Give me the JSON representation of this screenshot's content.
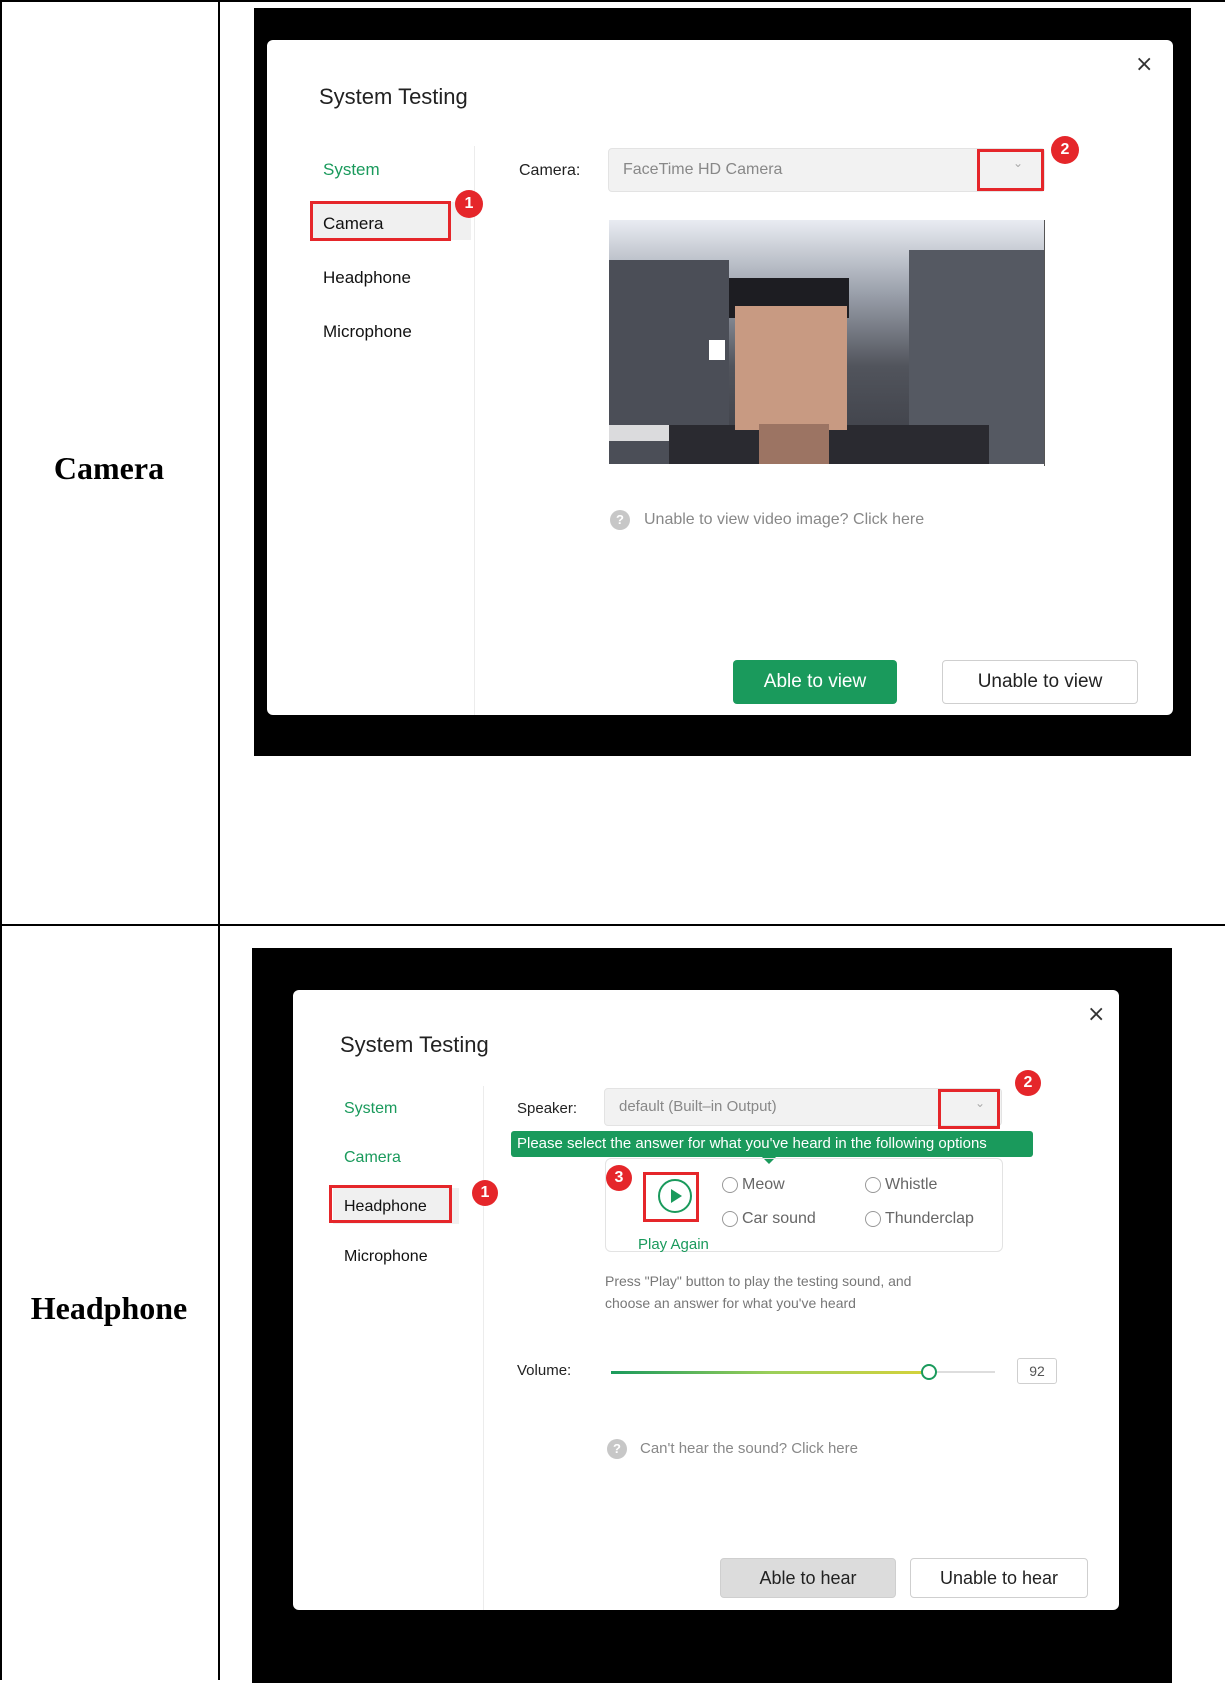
{
  "rows": [
    {
      "label": "Camera",
      "dialog": {
        "title": "System Testing",
        "nav": [
          "System",
          "Camera",
          "Headphone",
          "Microphone"
        ],
        "field_label": "Camera:",
        "select_value": "FaceTime HD Camera",
        "help_text": "Unable to view video image? Click here",
        "buttons": [
          "Able to view",
          "Unable to view"
        ],
        "badges": [
          "1",
          "2"
        ]
      }
    },
    {
      "label": "Headphone",
      "dialog": {
        "title": "System Testing",
        "nav": [
          "System",
          "Camera",
          "Headphone",
          "Microphone"
        ],
        "field_label": "Speaker:",
        "select_value": "default (Built–in Output)",
        "tooltip": "Please select the answer for what you've heard in the following options",
        "options": [
          "Meow",
          "Whistle",
          "Car sound",
          "Thunderclap"
        ],
        "play_again": "Play Again",
        "instructions_line1": "Press \"Play\" button to play the testing sound, and",
        "instructions_line2": "choose an answer for what you've heard",
        "volume_label": "Volume:",
        "volume_value": "92",
        "volume_level": 0.92,
        "help_text": "Can't hear the sound? Click here",
        "buttons": [
          "Able to hear",
          "Unable to hear"
        ],
        "badges": [
          "1",
          "2",
          "3"
        ]
      }
    }
  ],
  "icons": {
    "close": "×",
    "chevron": "⌄",
    "help": "?"
  },
  "colors": {
    "accent_green": "#1a9a5c",
    "annotation_red": "#e5262a"
  }
}
